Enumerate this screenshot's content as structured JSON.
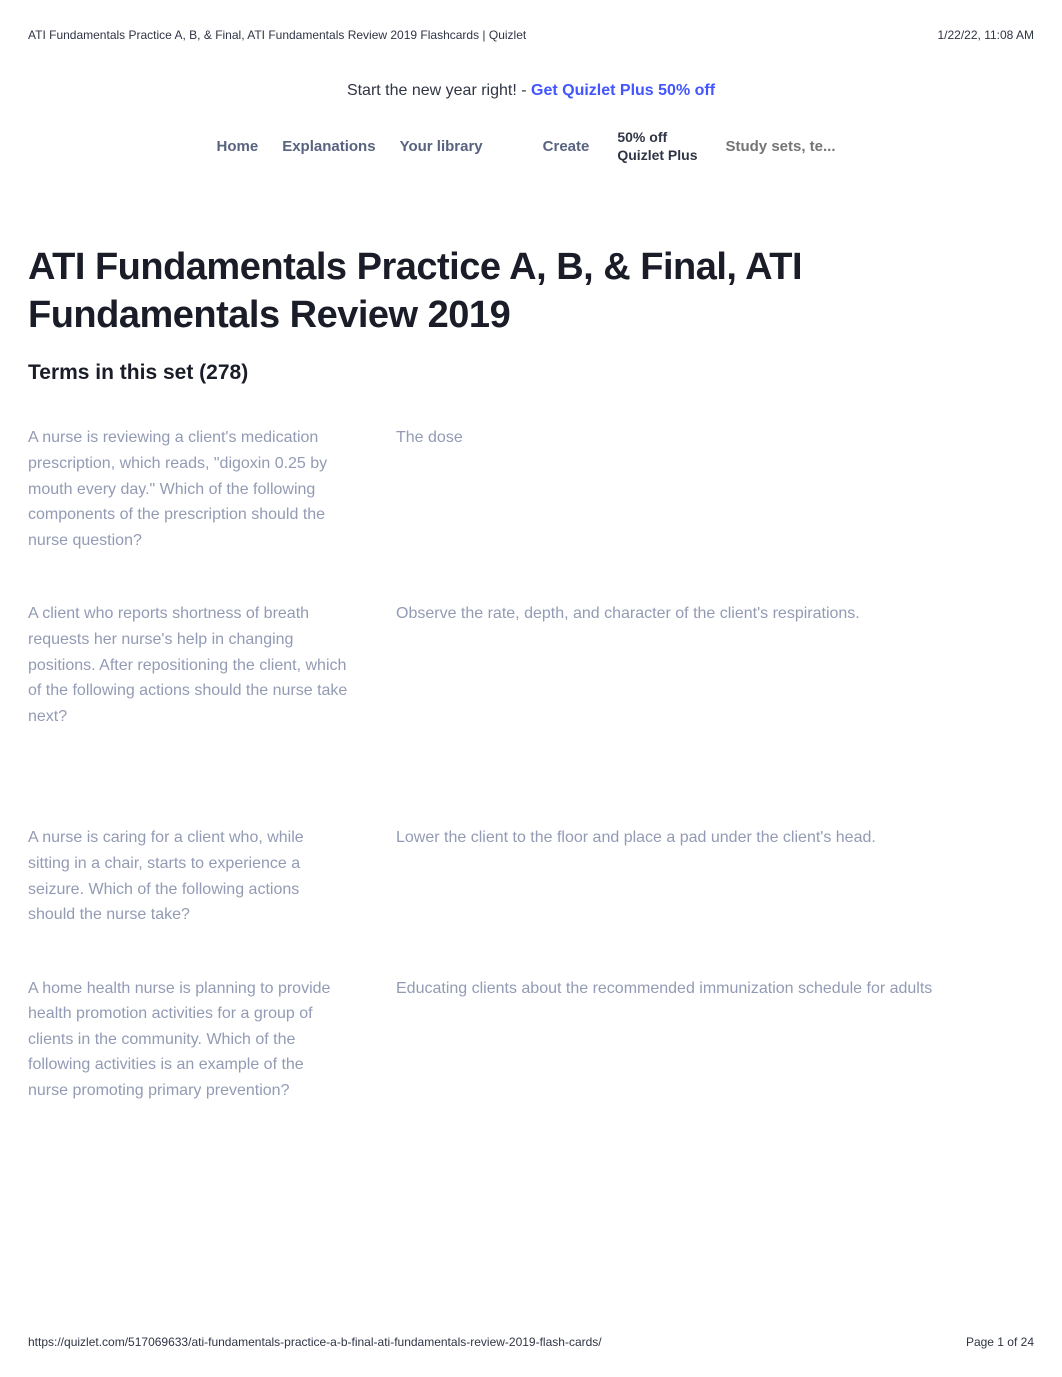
{
  "header": {
    "left": "ATI Fundamentals Practice A, B, & Final, ATI Fundamentals Review 2019 Flashcards | Quizlet",
    "right": "1/22/22, 11:08 AM"
  },
  "promo": {
    "prefix": "Start the new year right! - ",
    "link": "Get Quizlet Plus 50% off"
  },
  "nav": {
    "home": "Home",
    "explanations": "Explanations",
    "library": "Your library",
    "create": "Create",
    "pill_line1": "50% off",
    "pill_line2": "Quizlet Plus",
    "search_placeholder": "Study sets, te..."
  },
  "title": "ATI Fundamentals Practice A, B, & Final, ATI Fundamentals Review 2019",
  "terms_heading": "Terms in this set (278)",
  "cards": [
    {
      "term": "A nurse is reviewing a client's medication prescription, which reads, \"digoxin 0.25 by mouth every day.\" Which of the following components of the prescription should the nurse question?",
      "definition": "The dose"
    },
    {
      "term": "A client who reports shortness of breath requests her nurse's help in changing positions. After repositioning the client, which of the following actions should the nurse take next?",
      "definition": "Observe the rate, depth, and character of the client's respirations."
    },
    {
      "term": "A nurse is caring for a client who, while sitting in a chair, starts to experience a seizure. Which of the following actions should the nurse take?",
      "definition": "Lower the client to the floor and place a pad under the client's head."
    },
    {
      "term": "A home health nurse is planning to provide health promotion activities for a group of clients in the community. Which of the following activities is an example of the nurse promoting primary prevention?",
      "definition": "Educating clients about the recommended immunization schedule for adults"
    }
  ],
  "footer": {
    "url": "https://quizlet.com/517069633/ati-fundamentals-practice-a-b-final-ati-fundamentals-review-2019-flash-cards/",
    "page": "Page 1 of 24"
  }
}
